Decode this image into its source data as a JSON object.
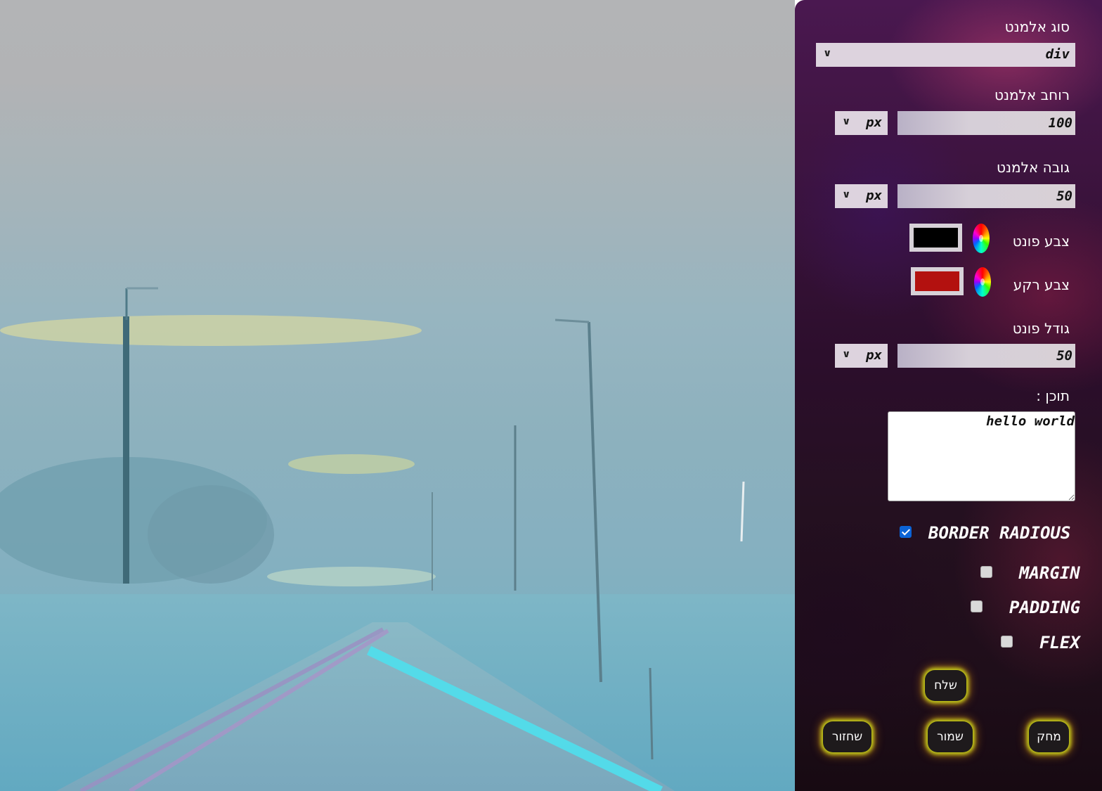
{
  "form": {
    "element_type": {
      "label": "סוג  אלמנט",
      "value": "div"
    },
    "width": {
      "label": "רוחב  אלמנט",
      "value": "100",
      "unit": "px"
    },
    "height": {
      "label": "גובה  אלמנט",
      "value": "50",
      "unit": "px"
    },
    "font_color": {
      "label": "צבע  פונט",
      "color": "#000000"
    },
    "bg_color": {
      "label": "צבע  רקע",
      "color": "#b3110f"
    },
    "font_size": {
      "label": "גודל  פונט",
      "value": "50",
      "unit": "px"
    },
    "content": {
      "label": "תוכן  :",
      "value": "hello world"
    }
  },
  "options": [
    {
      "key": "border_radius",
      "label": "BORDER RADIOUS",
      "checked": true
    },
    {
      "key": "margin",
      "label": "MARGIN",
      "checked": false
    },
    {
      "key": "padding",
      "label": "PADDING",
      "checked": false
    },
    {
      "key": "flex",
      "label": "FLEX",
      "checked": false
    }
  ],
  "buttons": {
    "send": "שלח",
    "return": "שחזור",
    "save": "שמור",
    "delete": "מחק"
  },
  "theme": {
    "button_glow": "#c7d31a",
    "checkbox_accent": "#0b63d6"
  }
}
